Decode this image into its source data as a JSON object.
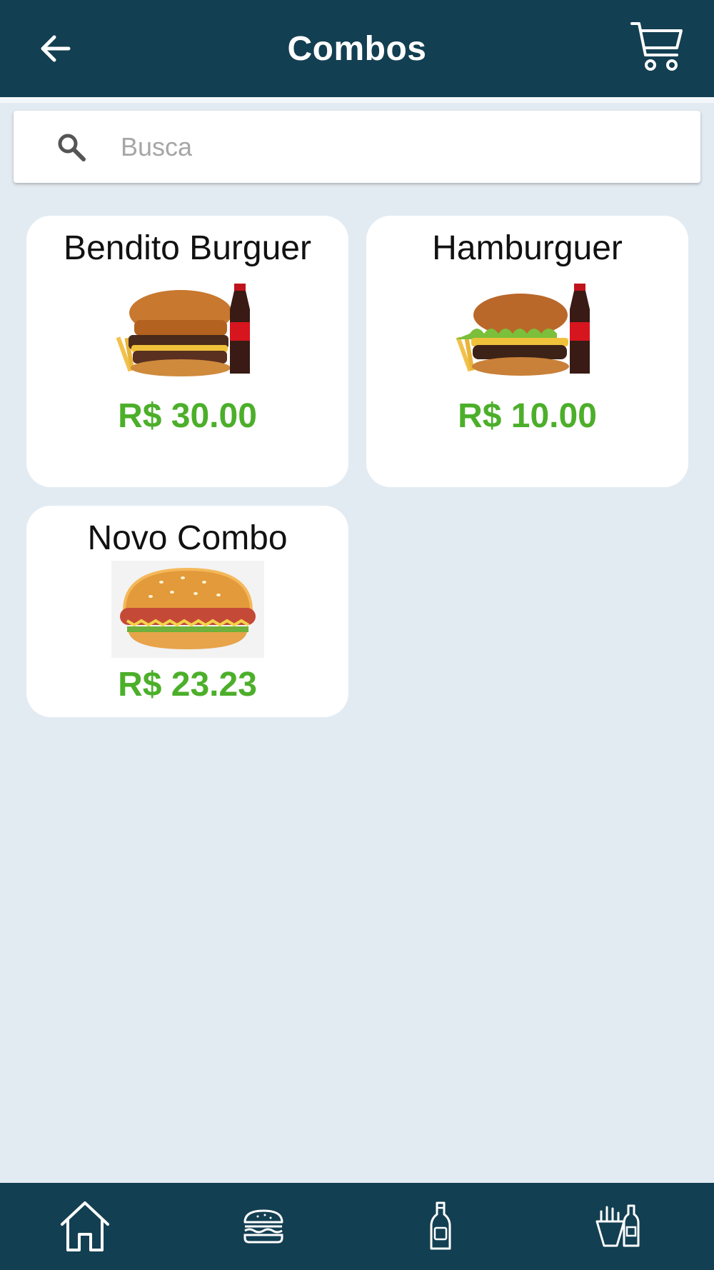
{
  "header": {
    "title": "Combos",
    "back_icon": "arrow-left-icon",
    "cart_icon": "cart-icon"
  },
  "search": {
    "placeholder": "Busca",
    "value": ""
  },
  "combos": [
    {
      "name": "Bendito Burguer",
      "price": "R$ 30.00",
      "image": "burger-with-coke-and-fries"
    },
    {
      "name": "Hamburguer",
      "price": "R$ 10.00",
      "image": "burger-with-lettuce-coke-and-fries"
    },
    {
      "name": "Novo Combo",
      "price": "R$ 23.23",
      "image": "hotdog-burger-illustration"
    }
  ],
  "bottom_nav": [
    {
      "icon": "home-icon"
    },
    {
      "icon": "burger-icon"
    },
    {
      "icon": "bottle-icon"
    },
    {
      "icon": "fries-and-drink-icon"
    }
  ],
  "colors": {
    "bar": "#133f52",
    "background": "#e3ebf2",
    "price": "#4caf2a"
  }
}
